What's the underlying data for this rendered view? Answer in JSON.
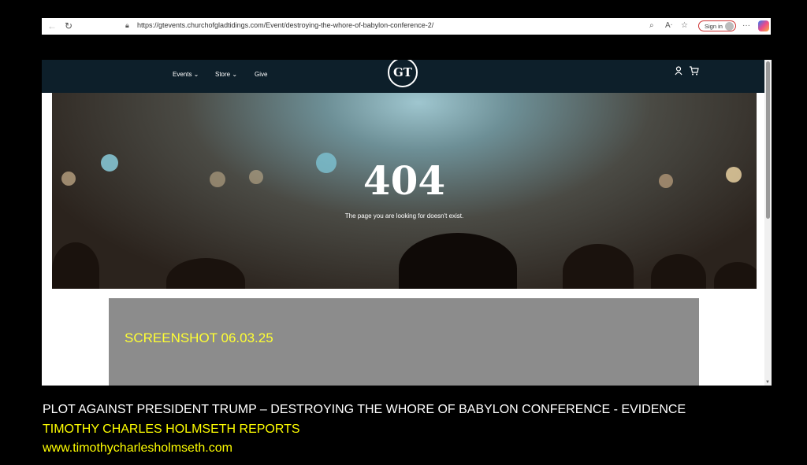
{
  "browser": {
    "url": "https://gtevents.churchofgladtidings.com/Event/destroying-the-whore-of-babylon-conference-2/",
    "sign_in_label": "Sign in",
    "more_label": "···"
  },
  "site_nav": {
    "items": [
      {
        "label": "Events ⌄"
      },
      {
        "label": "Store ⌄"
      },
      {
        "label": "Give"
      }
    ],
    "logo_text": "GT"
  },
  "hero": {
    "code": "404",
    "message": "The page you are looking for doesn't exist."
  },
  "overlay": {
    "screenshot_stamp": "SCREENSHOT 06.03.25"
  },
  "captions": {
    "line1": "PLOT AGAINST PRESIDENT TRUMP – DESTROYING THE WHORE OF BABYLON CONFERENCE - EVIDENCE",
    "line2": "TIMOTHY CHARLES HOLMSETH REPORTS",
    "line3": "www.timothycharlesholmseth.com"
  },
  "colors": {
    "nav_bg": "#0d1f2a",
    "caption_yellow": "#ffff00",
    "stamp_yellow": "#ffff33",
    "panel_gray": "#8c8c8c"
  },
  "icons": [
    "back-arrow-icon",
    "refresh-icon",
    "lock-icon",
    "zoom-icon",
    "read-aloud-icon",
    "favorite-star-icon",
    "user-icon",
    "cart-icon",
    "copilot-icon"
  ]
}
